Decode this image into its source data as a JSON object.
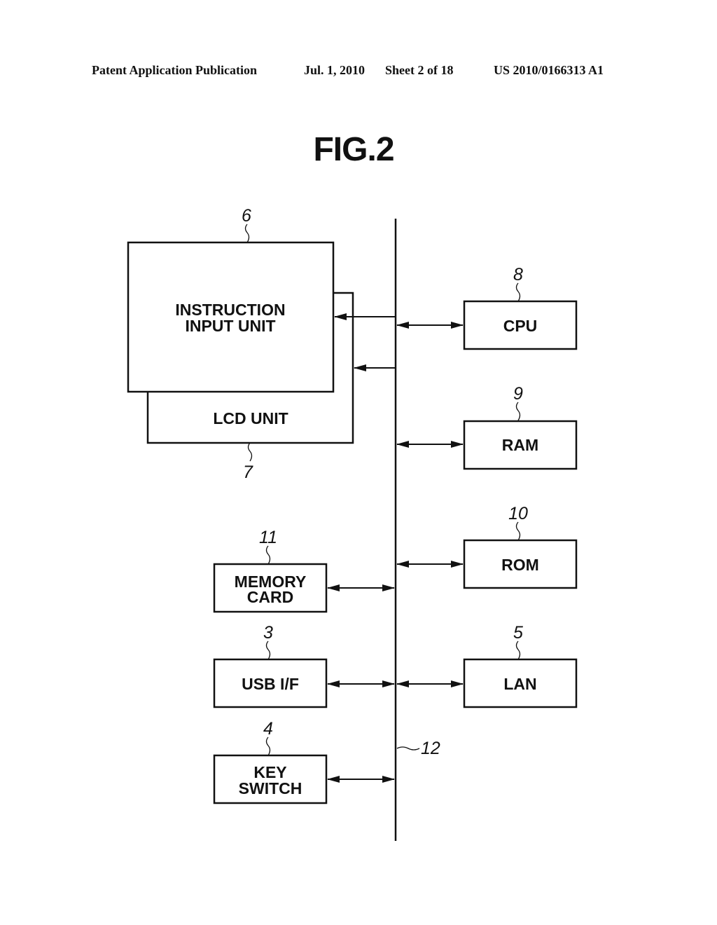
{
  "header": {
    "publication": "Patent Application Publication",
    "date": "Jul. 1, 2010",
    "sheet": "Sheet 2 of 18",
    "number": "US 2010/0166313 A1"
  },
  "figure": {
    "title": "FIG.2"
  },
  "blocks": {
    "instruction_input_unit": {
      "ref": "6",
      "line1": "INSTRUCTION",
      "line2": "INPUT UNIT"
    },
    "lcd_unit": {
      "ref": "7",
      "line1": "LCD UNIT"
    },
    "cpu": {
      "ref": "8",
      "line1": "CPU"
    },
    "ram": {
      "ref": "9",
      "line1": "RAM"
    },
    "rom": {
      "ref": "10",
      "line1": "ROM"
    },
    "memory_card": {
      "ref": "11",
      "line1": "MEMORY",
      "line2": "CARD"
    },
    "usb_if": {
      "ref": "3",
      "line1": "USB I/F"
    },
    "lan": {
      "ref": "5",
      "line1": "LAN"
    },
    "key_switch": {
      "ref": "4",
      "line1": "KEY",
      "line2": "SWITCH"
    }
  },
  "bus": {
    "ref": "12"
  },
  "connections": [
    {
      "from": "bus",
      "to": "instruction_input_unit",
      "direction": "one-way"
    },
    {
      "from": "bus",
      "to": "lcd_unit",
      "direction": "one-way"
    },
    {
      "from": "bus",
      "to": "cpu",
      "direction": "bidirectional"
    },
    {
      "from": "bus",
      "to": "ram",
      "direction": "bidirectional"
    },
    {
      "from": "bus",
      "to": "rom",
      "direction": "bidirectional"
    },
    {
      "from": "bus",
      "to": "memory_card",
      "direction": "bidirectional"
    },
    {
      "from": "bus",
      "to": "usb_if",
      "direction": "bidirectional"
    },
    {
      "from": "bus",
      "to": "lan",
      "direction": "bidirectional"
    },
    {
      "from": "bus",
      "to": "key_switch",
      "direction": "bidirectional"
    }
  ]
}
